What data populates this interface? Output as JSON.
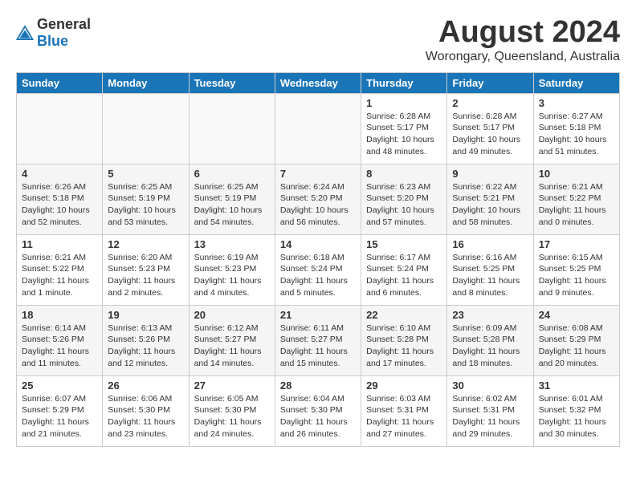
{
  "header": {
    "logo_general": "General",
    "logo_blue": "Blue",
    "title": "August 2024",
    "subtitle": "Worongary, Queensland, Australia"
  },
  "calendar": {
    "days_of_week": [
      "Sunday",
      "Monday",
      "Tuesday",
      "Wednesday",
      "Thursday",
      "Friday",
      "Saturday"
    ],
    "weeks": [
      [
        {
          "day": "",
          "info": ""
        },
        {
          "day": "",
          "info": ""
        },
        {
          "day": "",
          "info": ""
        },
        {
          "day": "",
          "info": ""
        },
        {
          "day": "1",
          "info": "Sunrise: 6:28 AM\nSunset: 5:17 PM\nDaylight: 10 hours and 48 minutes."
        },
        {
          "day": "2",
          "info": "Sunrise: 6:28 AM\nSunset: 5:17 PM\nDaylight: 10 hours and 49 minutes."
        },
        {
          "day": "3",
          "info": "Sunrise: 6:27 AM\nSunset: 5:18 PM\nDaylight: 10 hours and 51 minutes."
        }
      ],
      [
        {
          "day": "4",
          "info": "Sunrise: 6:26 AM\nSunset: 5:18 PM\nDaylight: 10 hours and 52 minutes."
        },
        {
          "day": "5",
          "info": "Sunrise: 6:25 AM\nSunset: 5:19 PM\nDaylight: 10 hours and 53 minutes."
        },
        {
          "day": "6",
          "info": "Sunrise: 6:25 AM\nSunset: 5:19 PM\nDaylight: 10 hours and 54 minutes."
        },
        {
          "day": "7",
          "info": "Sunrise: 6:24 AM\nSunset: 5:20 PM\nDaylight: 10 hours and 56 minutes."
        },
        {
          "day": "8",
          "info": "Sunrise: 6:23 AM\nSunset: 5:20 PM\nDaylight: 10 hours and 57 minutes."
        },
        {
          "day": "9",
          "info": "Sunrise: 6:22 AM\nSunset: 5:21 PM\nDaylight: 10 hours and 58 minutes."
        },
        {
          "day": "10",
          "info": "Sunrise: 6:21 AM\nSunset: 5:22 PM\nDaylight: 11 hours and 0 minutes."
        }
      ],
      [
        {
          "day": "11",
          "info": "Sunrise: 6:21 AM\nSunset: 5:22 PM\nDaylight: 11 hours and 1 minute."
        },
        {
          "day": "12",
          "info": "Sunrise: 6:20 AM\nSunset: 5:23 PM\nDaylight: 11 hours and 2 minutes."
        },
        {
          "day": "13",
          "info": "Sunrise: 6:19 AM\nSunset: 5:23 PM\nDaylight: 11 hours and 4 minutes."
        },
        {
          "day": "14",
          "info": "Sunrise: 6:18 AM\nSunset: 5:24 PM\nDaylight: 11 hours and 5 minutes."
        },
        {
          "day": "15",
          "info": "Sunrise: 6:17 AM\nSunset: 5:24 PM\nDaylight: 11 hours and 6 minutes."
        },
        {
          "day": "16",
          "info": "Sunrise: 6:16 AM\nSunset: 5:25 PM\nDaylight: 11 hours and 8 minutes."
        },
        {
          "day": "17",
          "info": "Sunrise: 6:15 AM\nSunset: 5:25 PM\nDaylight: 11 hours and 9 minutes."
        }
      ],
      [
        {
          "day": "18",
          "info": "Sunrise: 6:14 AM\nSunset: 5:26 PM\nDaylight: 11 hours and 11 minutes."
        },
        {
          "day": "19",
          "info": "Sunrise: 6:13 AM\nSunset: 5:26 PM\nDaylight: 11 hours and 12 minutes."
        },
        {
          "day": "20",
          "info": "Sunrise: 6:12 AM\nSunset: 5:27 PM\nDaylight: 11 hours and 14 minutes."
        },
        {
          "day": "21",
          "info": "Sunrise: 6:11 AM\nSunset: 5:27 PM\nDaylight: 11 hours and 15 minutes."
        },
        {
          "day": "22",
          "info": "Sunrise: 6:10 AM\nSunset: 5:28 PM\nDaylight: 11 hours and 17 minutes."
        },
        {
          "day": "23",
          "info": "Sunrise: 6:09 AM\nSunset: 5:28 PM\nDaylight: 11 hours and 18 minutes."
        },
        {
          "day": "24",
          "info": "Sunrise: 6:08 AM\nSunset: 5:29 PM\nDaylight: 11 hours and 20 minutes."
        }
      ],
      [
        {
          "day": "25",
          "info": "Sunrise: 6:07 AM\nSunset: 5:29 PM\nDaylight: 11 hours and 21 minutes."
        },
        {
          "day": "26",
          "info": "Sunrise: 6:06 AM\nSunset: 5:30 PM\nDaylight: 11 hours and 23 minutes."
        },
        {
          "day": "27",
          "info": "Sunrise: 6:05 AM\nSunset: 5:30 PM\nDaylight: 11 hours and 24 minutes."
        },
        {
          "day": "28",
          "info": "Sunrise: 6:04 AM\nSunset: 5:30 PM\nDaylight: 11 hours and 26 minutes."
        },
        {
          "day": "29",
          "info": "Sunrise: 6:03 AM\nSunset: 5:31 PM\nDaylight: 11 hours and 27 minutes."
        },
        {
          "day": "30",
          "info": "Sunrise: 6:02 AM\nSunset: 5:31 PM\nDaylight: 11 hours and 29 minutes."
        },
        {
          "day": "31",
          "info": "Sunrise: 6:01 AM\nSunset: 5:32 PM\nDaylight: 11 hours and 30 minutes."
        }
      ]
    ]
  }
}
